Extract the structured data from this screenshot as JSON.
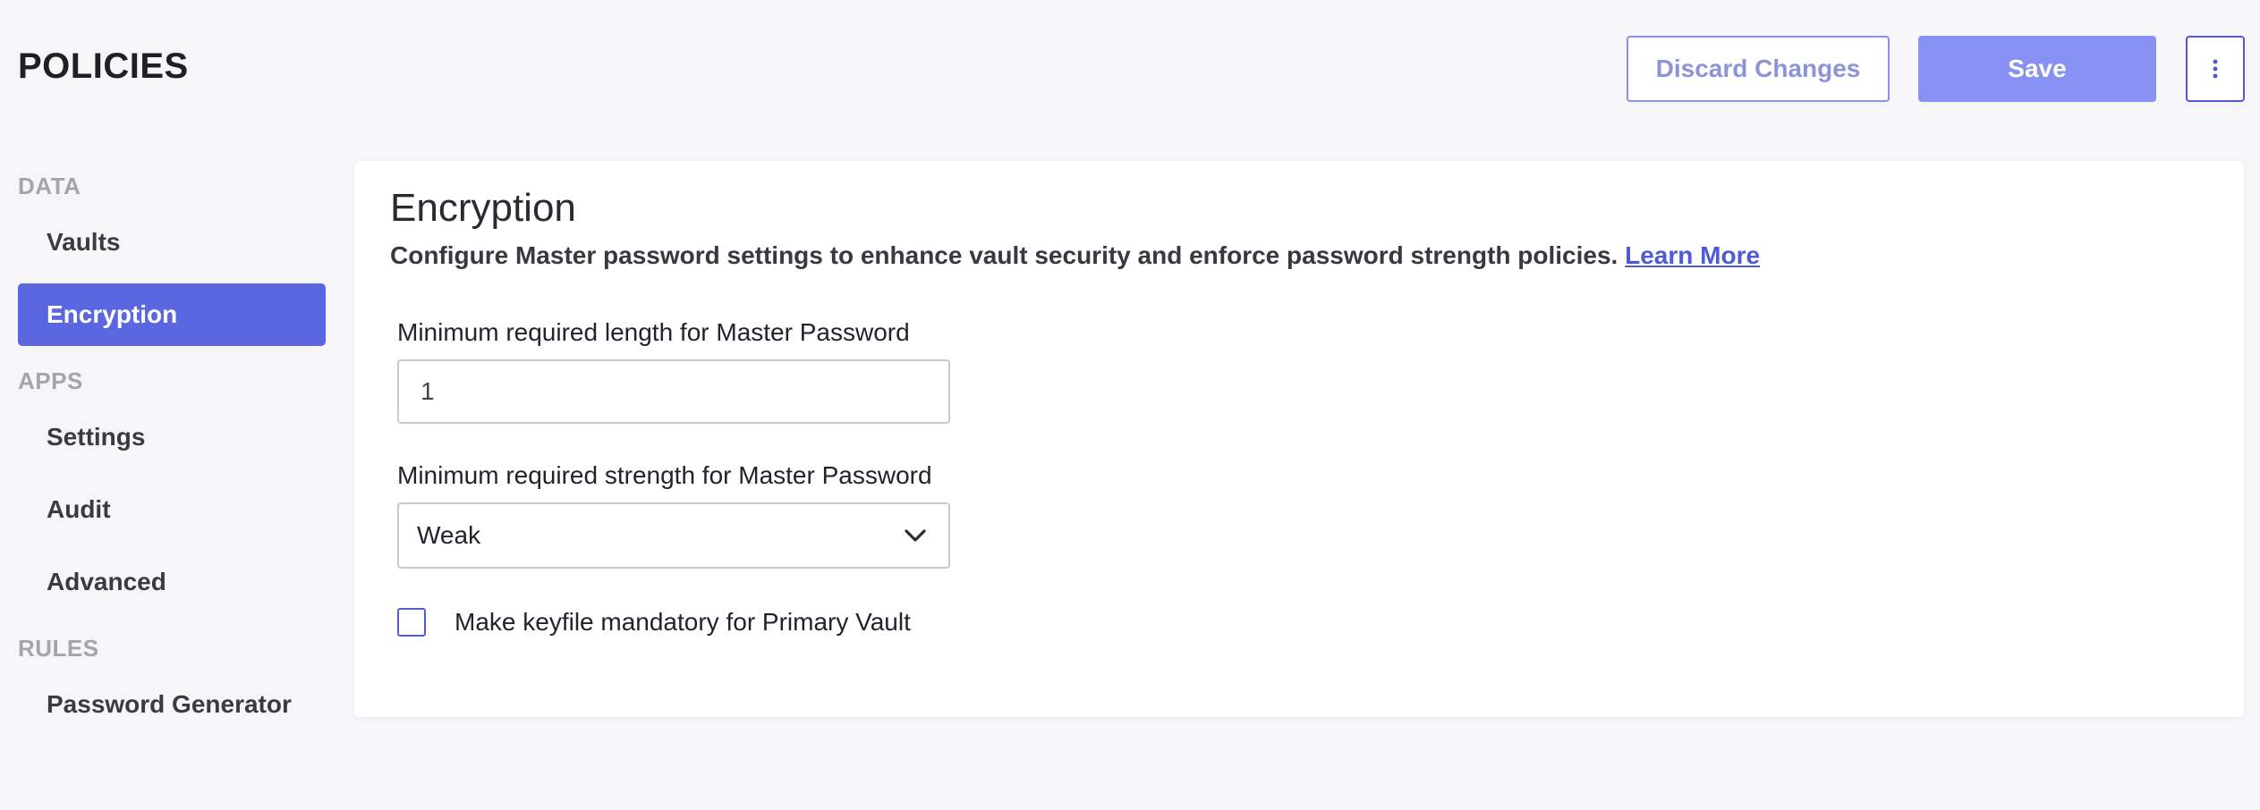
{
  "header": {
    "title": "POLICIES",
    "discard_label": "Discard Changes",
    "save_label": "Save",
    "more_icon": "vertical-ellipsis-icon"
  },
  "sidebar": {
    "sections": [
      {
        "label": "DATA",
        "items": [
          {
            "label": "Vaults"
          },
          {
            "label": "Encryption",
            "active": true
          }
        ]
      },
      {
        "label": "APPS",
        "items": [
          {
            "label": "Settings"
          },
          {
            "label": "Audit"
          },
          {
            "label": "Advanced"
          }
        ]
      },
      {
        "label": "RULES",
        "items": [
          {
            "label": "Password Generator"
          }
        ]
      }
    ]
  },
  "main": {
    "title": "Encryption",
    "description": "Configure Master password settings to enhance vault security and enforce password strength policies.",
    "learn_more": "Learn More",
    "min_length": {
      "label": "Minimum required length for Master Password",
      "value": "1"
    },
    "min_strength": {
      "label": "Minimum required strength for Master Password",
      "selected": "Weak",
      "icon": "chevron-down-icon"
    },
    "keyfile": {
      "label": "Make keyfile mandatory for Primary Vault",
      "checked": false
    }
  },
  "colors": {
    "accent": "#5a67e0",
    "save_button": "#8791f4",
    "background": "#f6f6f9",
    "link": "#4f5bd5"
  }
}
